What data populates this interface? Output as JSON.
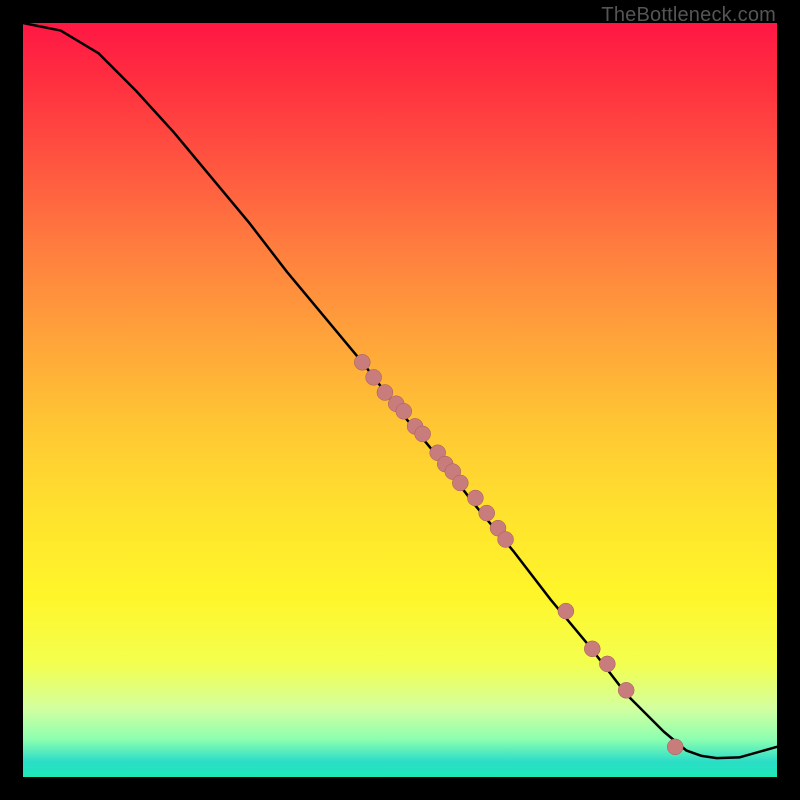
{
  "attribution": "TheBottleneck.com",
  "colors": {
    "background": "#000000",
    "line": "#000000",
    "marker_fill": "#c97c7c",
    "marker_stroke": "#a55a5a"
  },
  "chart_data": {
    "type": "line",
    "title": "",
    "xlabel": "",
    "ylabel": "",
    "xlim": [
      0,
      100
    ],
    "ylim": [
      0,
      100
    ],
    "series": [
      {
        "name": "curve",
        "x": [
          0,
          5,
          10,
          15,
          20,
          25,
          30,
          35,
          40,
          45,
          50,
          55,
          60,
          65,
          70,
          75,
          80,
          85,
          88,
          90,
          92,
          95,
          100
        ],
        "y": [
          100,
          99,
          96,
          91,
          85.5,
          79.5,
          73.5,
          67,
          61,
          55,
          48.5,
          42.5,
          36,
          30,
          23.5,
          17.5,
          11,
          6,
          3.5,
          2.8,
          2.5,
          2.6,
          4
        ]
      }
    ],
    "markers": {
      "name": "highlighted_points",
      "x": [
        45,
        46.5,
        48,
        49.5,
        50.5,
        52,
        53,
        55,
        56,
        57,
        58,
        60,
        61.5,
        63,
        64,
        72,
        75.5,
        77.5,
        80,
        86.5
      ],
      "y": [
        55,
        53,
        51,
        49.5,
        48.5,
        46.5,
        45.5,
        43,
        41.5,
        40.5,
        39,
        37,
        35,
        33,
        31.5,
        22,
        17,
        15,
        11.5,
        4
      ]
    }
  }
}
